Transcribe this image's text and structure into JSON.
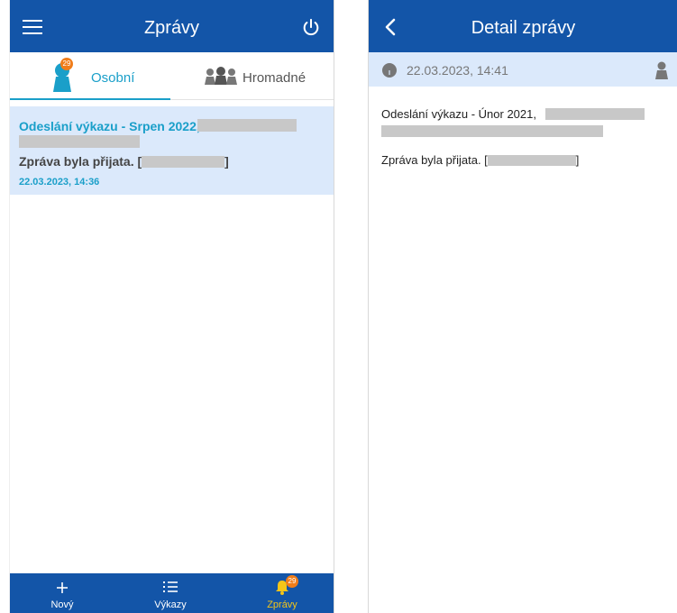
{
  "list_screen": {
    "title": "Zprávy",
    "tabs": [
      {
        "label": "Osobní",
        "badge": "29",
        "active": true,
        "icon": "person-icon"
      },
      {
        "label": "Hromadné",
        "active": false,
        "icon": "group-icon"
      }
    ],
    "message": {
      "subject": "Odeslání výkazu - Srpen 2022,",
      "body_prefix": "Zpráva byla přijata. [",
      "body_suffix": "]",
      "timestamp": "22.03.2023, 14:36"
    },
    "bottom_nav": [
      {
        "label": "Nový",
        "icon": "plus-icon"
      },
      {
        "label": "Výkazy",
        "icon": "list-icon"
      },
      {
        "label": "Zprávy",
        "icon": "bell-icon",
        "badge": "29",
        "active": true
      }
    ]
  },
  "detail_screen": {
    "title": "Detail zprávy",
    "datetime": "22.03.2023, 14:41",
    "subject": "Odeslání výkazu - Únor 2021,",
    "body_prefix": "Zpráva byla přijata. [",
    "body_suffix": "]"
  },
  "colors": {
    "primary": "#1355a8",
    "accent": "#1a9fc9",
    "highlight_bg": "#dbe9fb",
    "badge": "#f07d1a",
    "active_nav": "#f5c518"
  }
}
